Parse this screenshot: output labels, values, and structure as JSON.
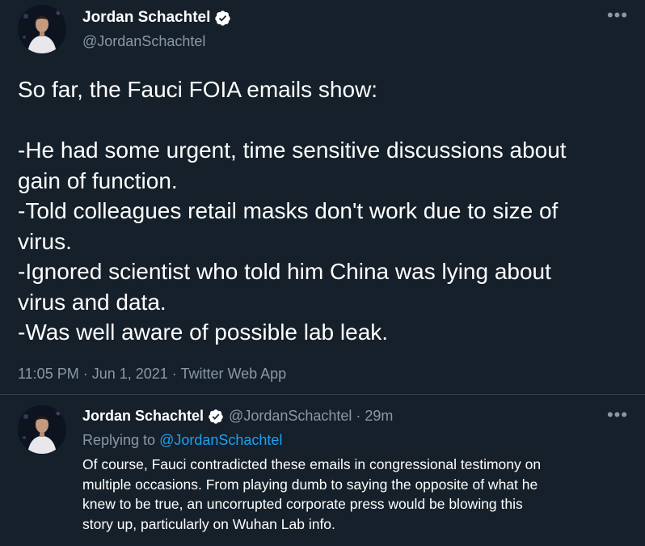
{
  "main_tweet": {
    "display_name": "Jordan Schachtel",
    "handle": "@JordanSchachtel",
    "more_icon": "more-horizontal-icon",
    "text_lines": [
      "So far, the Fauci FOIA emails show:",
      "",
      "-He had some urgent, time sensitive discussions about",
      "gain of function.",
      "-Told colleagues retail masks don't work due to size of",
      "virus.",
      "-Ignored scientist who told him China was lying about",
      "virus and data.",
      "-Was well aware of possible lab leak."
    ],
    "timestamp": "11:05 PM · Jun 1, 2021 · Twitter Web App"
  },
  "reply_tweet": {
    "display_name": "Jordan Schachtel",
    "handle": "@JordanSchachtel",
    "age": "· 29m",
    "replying_prefix": "Replying to ",
    "replying_to": "@JordanSchachtel",
    "text_lines": [
      "Of course, Fauci contradicted these emails in congressional testimony on",
      "multiple occasions. From playing dumb to saying the opposite of what he",
      "knew to be true, an uncorrupted corporate press would be blowing this",
      "story up, particularly on Wuhan Lab info."
    ]
  },
  "colors": {
    "background": "#15202b",
    "text": "#ffffff",
    "secondary": "#8899a6",
    "link": "#1da1f2",
    "divider": "#38444d"
  }
}
